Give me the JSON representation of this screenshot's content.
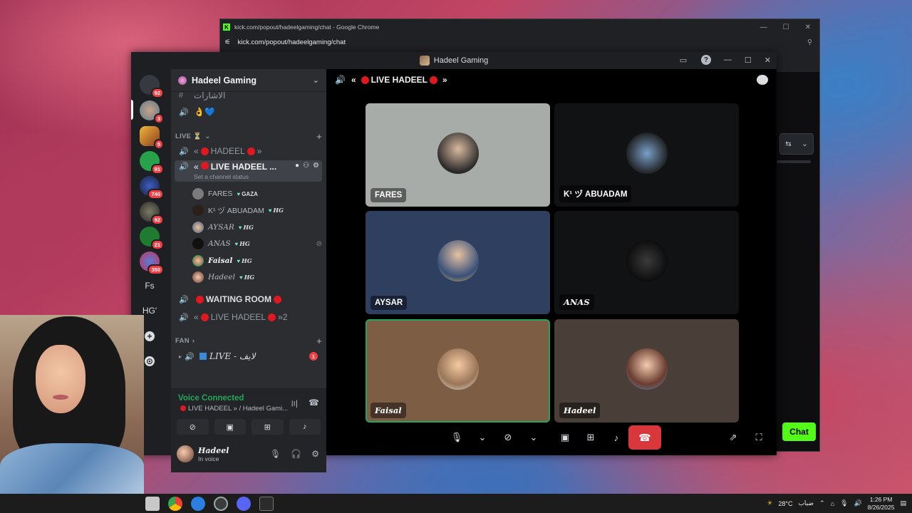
{
  "chrome": {
    "title": "kick.com/popout/hadeelgaming/chat - Google Chrome",
    "url": "kick.com/popout/hadeelgaming/chat",
    "chat_button": "Chat"
  },
  "discord": {
    "window_title": "Hadeel Gaming",
    "guild_name": "Hadeel Gaming",
    "rail_badges": [
      "92",
      "3",
      "5",
      "91",
      "740",
      "92",
      "21",
      "350"
    ],
    "rail_text_servers": [
      "Fs",
      "HG'"
    ],
    "channels": {
      "top_text": "الاشارات",
      "top_voice": "👌💙",
      "category_live": "LIVE ⏳",
      "ch_hadeel": "HADEEL",
      "ch_live_hadeel": "LIVE HADEEL ...",
      "channel_status": "Set a channel status",
      "ch_waiting": "WAITING ROOM",
      "ch_live2": "LIVE HADEEL",
      "ch_live2_suffix": "»2",
      "category_fan": "FAN",
      "ch_live_ar": "LIVE - لايف",
      "ch_live_ar_badge": "1"
    },
    "voice_users": [
      {
        "name": "FARES",
        "tag": "GAZA"
      },
      {
        "name": "K¹ ヅ ABUADAM",
        "tag": "HG"
      },
      {
        "name": "AYSAR",
        "tag": "HG"
      },
      {
        "name": "ANAS",
        "tag": "HG"
      },
      {
        "name": "Faisal",
        "tag": "HG"
      },
      {
        "name": "Hadeel",
        "tag": "HG"
      }
    ],
    "voice_panel": {
      "status": "Voice Connected",
      "location": "LIVE HADEEL » / Hadeel Gami..."
    },
    "user_panel": {
      "username": "Hadeel",
      "status": "In voice"
    },
    "stage": {
      "header": "LIVE HADEEL",
      "tiles": [
        "FARES",
        "K¹ ヅ ABUADAM",
        "AYSAR",
        "ANAS",
        "Faisal",
        "Hadeel"
      ]
    }
  },
  "taskbar": {
    "weather": "28°C",
    "weather_desc": "ضباب",
    "time": "1:26 PM",
    "date": "8/26/2025"
  }
}
